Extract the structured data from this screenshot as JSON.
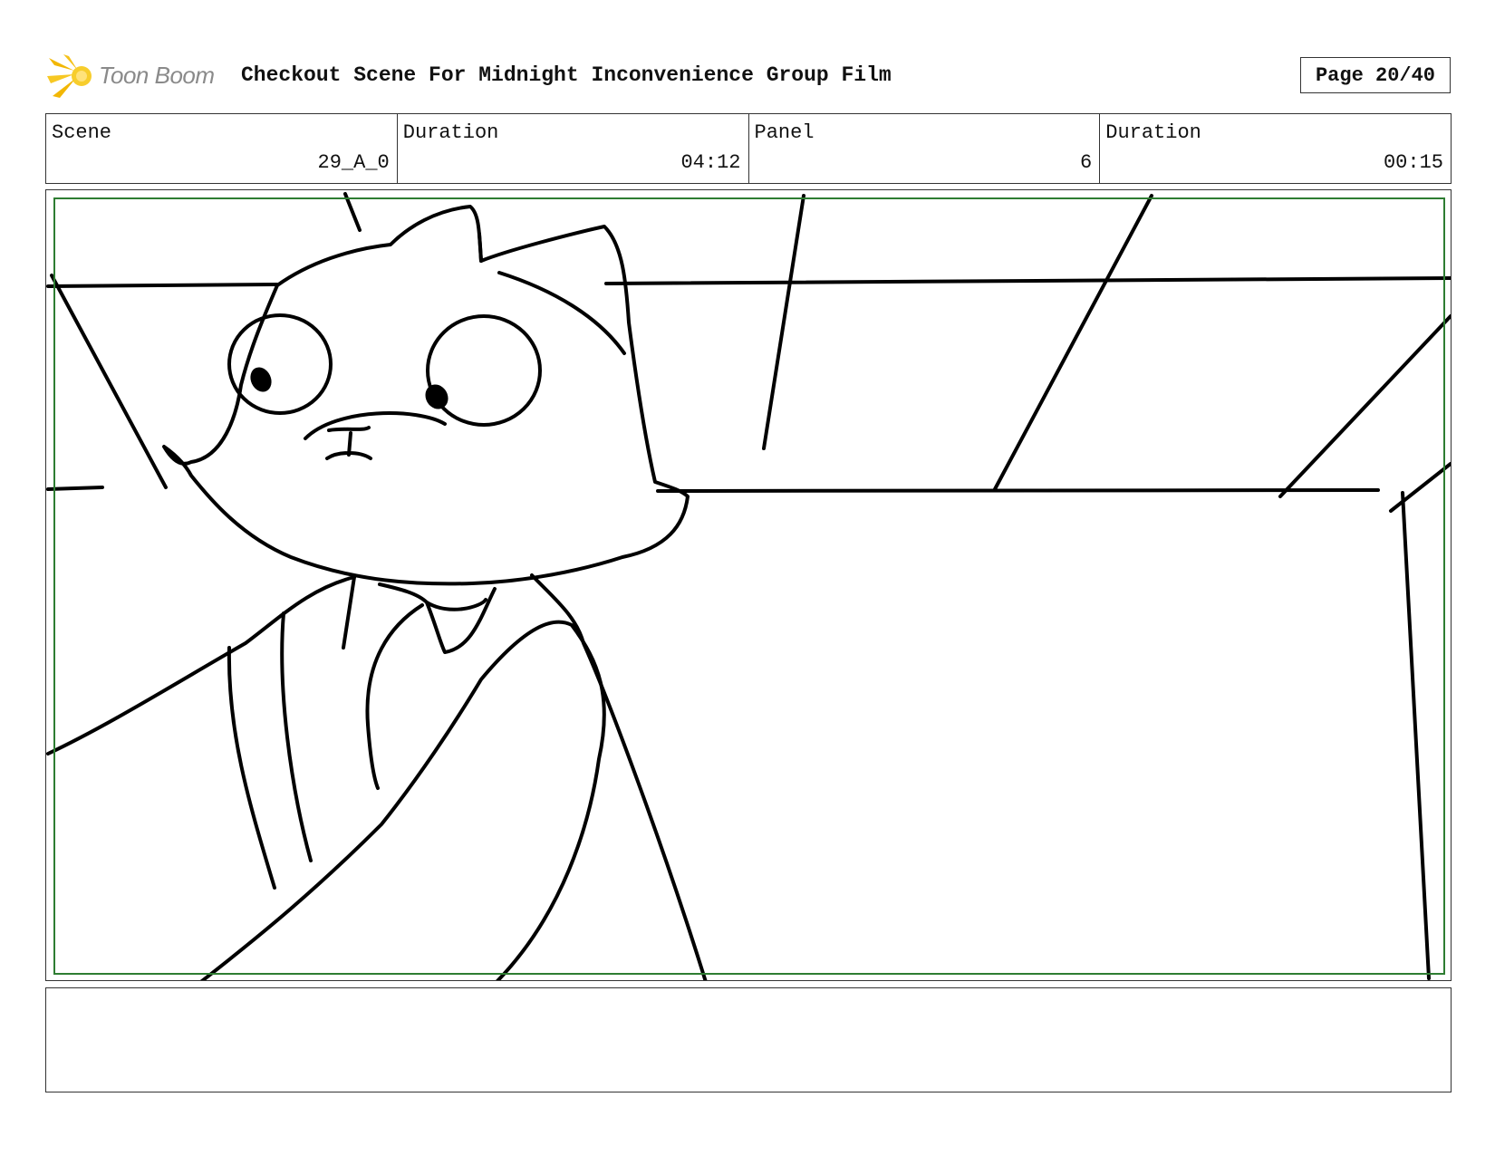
{
  "header": {
    "logo_text": "Toon Boom",
    "title": "Checkout Scene For Midnight Inconvenience Group Film",
    "page": "Page 20/40"
  },
  "info": [
    {
      "label": "Scene",
      "value": "29_A_0"
    },
    {
      "label": "Duration",
      "value": "04:12"
    },
    {
      "label": "Panel",
      "value": "6"
    },
    {
      "label": "Duration",
      "value": "00:15"
    }
  ],
  "panel": {
    "safe_frame_color": "#2e7d32",
    "subject": "cartoon cat character in shirt looking sideways, ceiling grid background"
  },
  "notes": {
    "text": ""
  }
}
